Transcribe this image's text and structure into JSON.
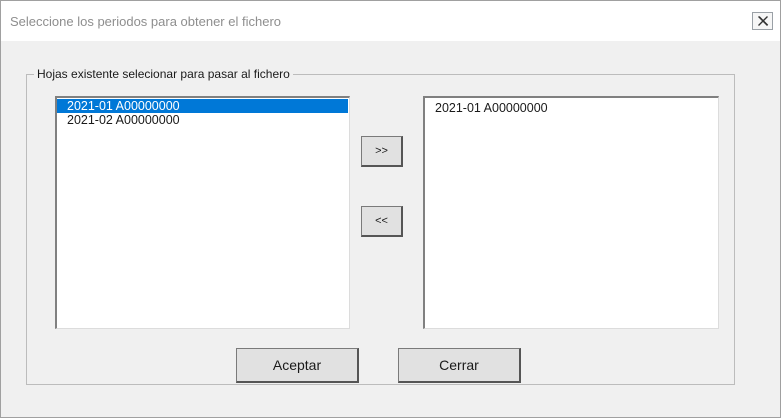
{
  "dialog": {
    "title": "Seleccione los periodos para obtener el fichero",
    "close_icon": "close-x-icon"
  },
  "group": {
    "label": "Hojas existente selecionar para pasar al fichero"
  },
  "available_list": {
    "items": [
      "2021-01  A00000000",
      "2021-02  A00000000"
    ],
    "selected_index": 0
  },
  "selected_list": {
    "items": [
      "2021-01  A00000000"
    ]
  },
  "buttons": {
    "add_label": ">>",
    "remove_label": "<<",
    "accept_label": "Aceptar",
    "close_label": "Cerrar"
  },
  "colors": {
    "selection": "#0078d7",
    "title_text": "#8e8e8e"
  }
}
